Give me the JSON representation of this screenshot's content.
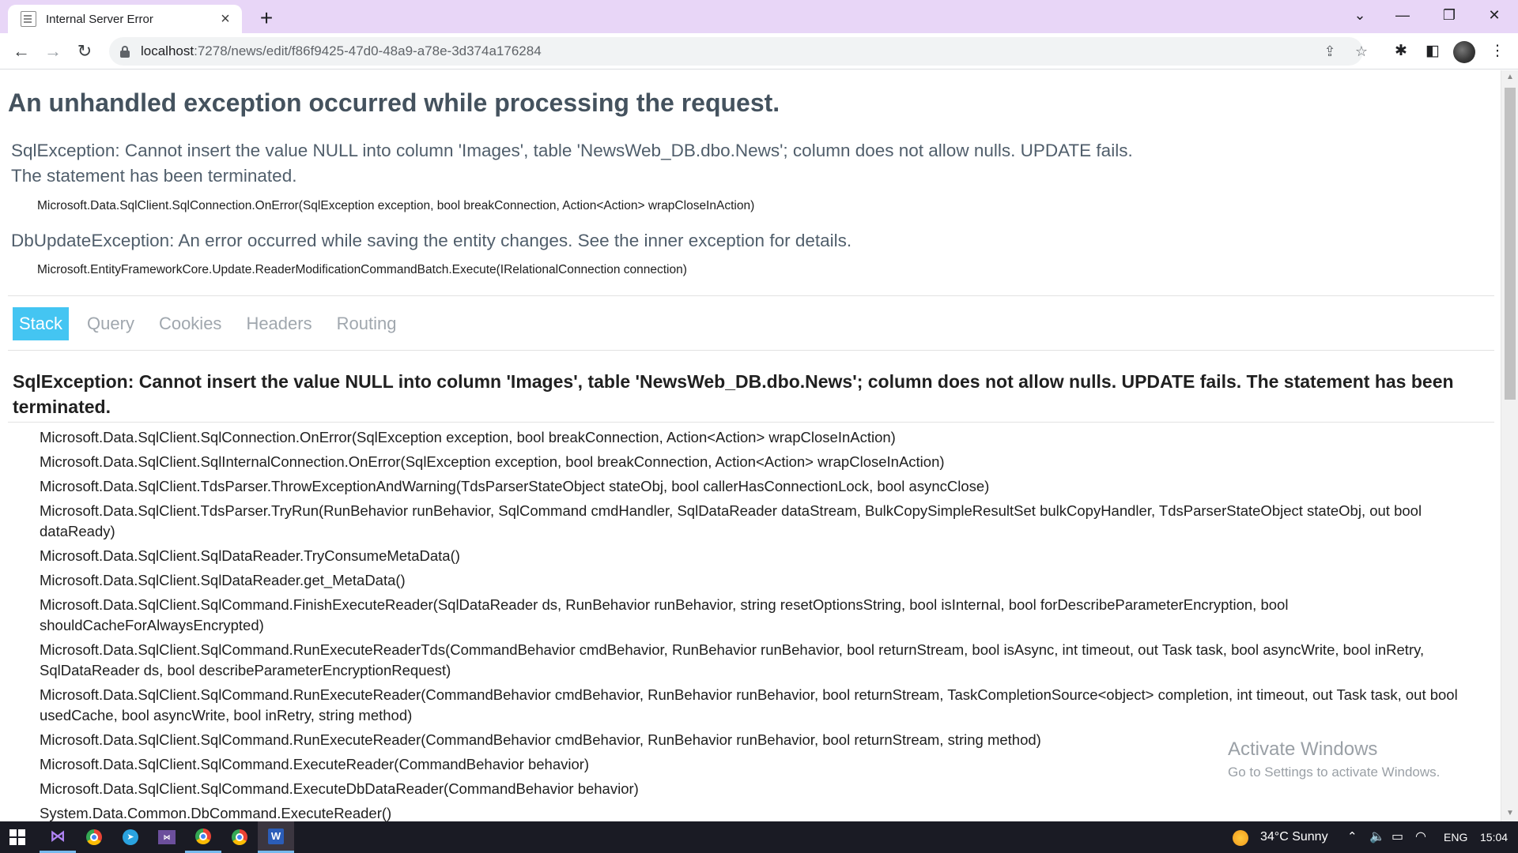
{
  "browser": {
    "tab_title": "Internal Server Error",
    "new_tab_symbol": "+",
    "url_host": "localhost",
    "url_path": ":7278/news/edit/f86f9425-47d0-48a9-a78e-3d374a176284"
  },
  "page": {
    "title": "An unhandled exception occurred while processing the request.",
    "exceptions": [
      {
        "message_line1": "SqlException: Cannot insert the value NULL into column 'Images', table 'NewsWeb_DB.dbo.News'; column does not allow nulls. UPDATE fails.",
        "message_line2": "The statement has been terminated.",
        "location": "Microsoft.Data.SqlClient.SqlConnection.OnError(SqlException exception, bool breakConnection, Action<Action> wrapCloseInAction)"
      },
      {
        "message_line1": "DbUpdateException: An error occurred while saving the entity changes. See the inner exception for details.",
        "location": "Microsoft.EntityFrameworkCore.Update.ReaderModificationCommandBatch.Execute(IRelationalConnection connection)"
      }
    ],
    "tabs": [
      "Stack",
      "Query",
      "Cookies",
      "Headers",
      "Routing"
    ],
    "selected_tab": "Stack",
    "stack_title": "SqlException: Cannot insert the value NULL into column 'Images', table 'NewsWeb_DB.dbo.News'; column does not allow nulls. UPDATE fails. The statement has been terminated.",
    "frames": [
      "Microsoft.Data.SqlClient.SqlConnection.OnError(SqlException exception, bool breakConnection, Action<Action> wrapCloseInAction)",
      "Microsoft.Data.SqlClient.SqlInternalConnection.OnError(SqlException exception, bool breakConnection, Action<Action> wrapCloseInAction)",
      "Microsoft.Data.SqlClient.TdsParser.ThrowExceptionAndWarning(TdsParserStateObject stateObj, bool callerHasConnectionLock, bool asyncClose)",
      "Microsoft.Data.SqlClient.TdsParser.TryRun(RunBehavior runBehavior, SqlCommand cmdHandler, SqlDataReader dataStream, BulkCopySimpleResultSet bulkCopyHandler, TdsParserStateObject stateObj, out bool dataReady)",
      "Microsoft.Data.SqlClient.SqlDataReader.TryConsumeMetaData()",
      "Microsoft.Data.SqlClient.SqlDataReader.get_MetaData()",
      "Microsoft.Data.SqlClient.SqlCommand.FinishExecuteReader(SqlDataReader ds, RunBehavior runBehavior, string resetOptionsString, bool isInternal, bool forDescribeParameterEncryption, bool shouldCacheForAlwaysEncrypted)",
      "Microsoft.Data.SqlClient.SqlCommand.RunExecuteReaderTds(CommandBehavior cmdBehavior, RunBehavior runBehavior, bool returnStream, bool isAsync, int timeout, out Task task, bool asyncWrite, bool inRetry, SqlDataReader ds, bool describeParameterEncryptionRequest)",
      "Microsoft.Data.SqlClient.SqlCommand.RunExecuteReader(CommandBehavior cmdBehavior, RunBehavior runBehavior, bool returnStream, TaskCompletionSource<object> completion, int timeout, out Task task, out bool usedCache, bool asyncWrite, bool inRetry, string method)",
      "Microsoft.Data.SqlClient.SqlCommand.RunExecuteReader(CommandBehavior cmdBehavior, RunBehavior runBehavior, bool returnStream, string method)",
      "Microsoft.Data.SqlClient.SqlCommand.ExecuteReader(CommandBehavior behavior)",
      "Microsoft.Data.SqlClient.SqlCommand.ExecuteDbDataReader(CommandBehavior behavior)",
      "System.Data.Common.DbCommand.ExecuteReader()"
    ]
  },
  "watermark": {
    "line1": "Activate Windows",
    "line2": "Go to Settings to activate Windows."
  },
  "taskbar": {
    "weather": "34°C  Sunny",
    "language": "ENG",
    "time": "15:04"
  },
  "colors": {
    "titlebar": "#e8d6f7",
    "accent_tab": "#44c5f2",
    "title_text": "#44525e",
    "taskbar": "#1a1b24"
  }
}
